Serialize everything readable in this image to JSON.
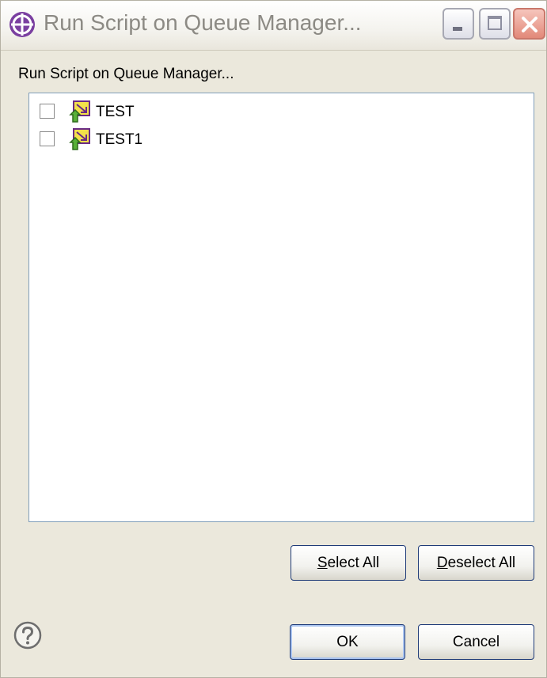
{
  "window": {
    "title": "Run Script on Queue Manager...",
    "title_color": "#8c8a84",
    "close_color": "#e28979"
  },
  "dialog": {
    "prompt": "Run Script on Queue Manager..."
  },
  "queue_managers": [
    {
      "label": "TEST",
      "checked": false,
      "icon": "queue-manager-icon"
    },
    {
      "label": "TEST1",
      "checked": false,
      "icon": "queue-manager-icon"
    }
  ],
  "buttons": {
    "select_all": {
      "mnemonic": "S",
      "rest": "elect All"
    },
    "deselect_all": {
      "mnemonic": "D",
      "rest": "eselect All"
    },
    "ok": "OK",
    "cancel": "Cancel"
  },
  "colors": {
    "dialog_bg": "#ebe8dc",
    "list_border": "#7f9db9",
    "button_border": "#1f3b78",
    "icon_green": "#58b038",
    "icon_yellow": "#f3e14a"
  }
}
